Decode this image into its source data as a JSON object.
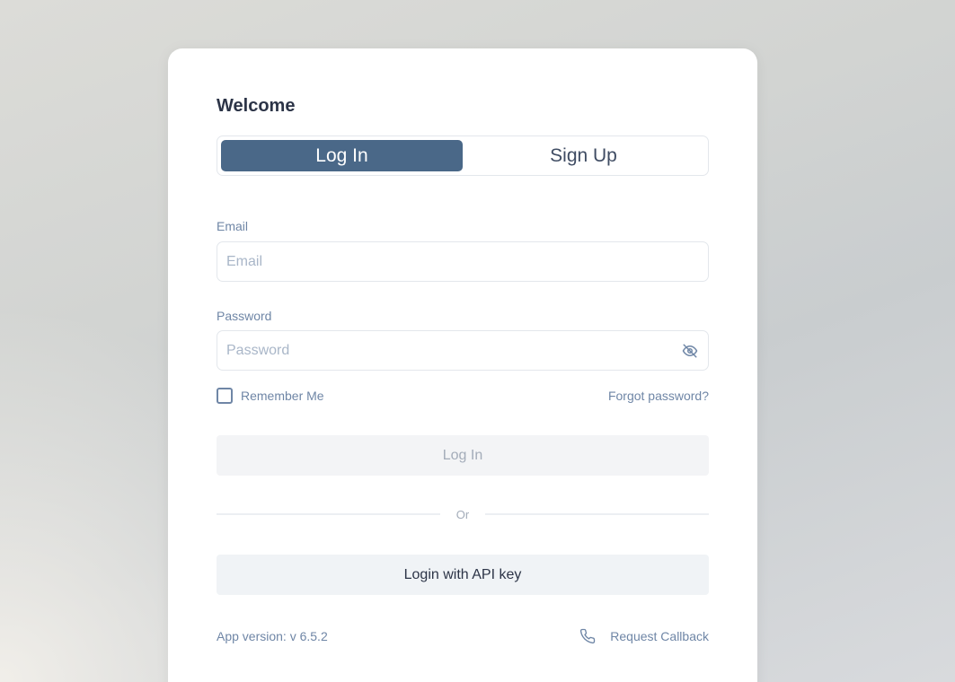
{
  "header": {
    "title": "Welcome"
  },
  "tabs": [
    {
      "label": "Log In",
      "active": true
    },
    {
      "label": "Sign Up",
      "active": false
    }
  ],
  "email": {
    "label": "Email",
    "placeholder": "Email",
    "value": ""
  },
  "password": {
    "label": "Password",
    "placeholder": "Password",
    "value": "",
    "toggle_icon": "eye-off-icon"
  },
  "remember": {
    "label": "Remember Me",
    "checked": false
  },
  "forgot": {
    "label": "Forgot password?"
  },
  "login_button": {
    "label": "Log In"
  },
  "divider": {
    "label": "Or"
  },
  "api_button": {
    "label": "Login with API key"
  },
  "footer": {
    "version": "App version: v 6.5.2",
    "callback_label": "Request Callback",
    "callback_icon": "phone-icon"
  },
  "colors": {
    "accent": "#4a6888",
    "label": "#6f86a6",
    "text": "#2c3447"
  }
}
